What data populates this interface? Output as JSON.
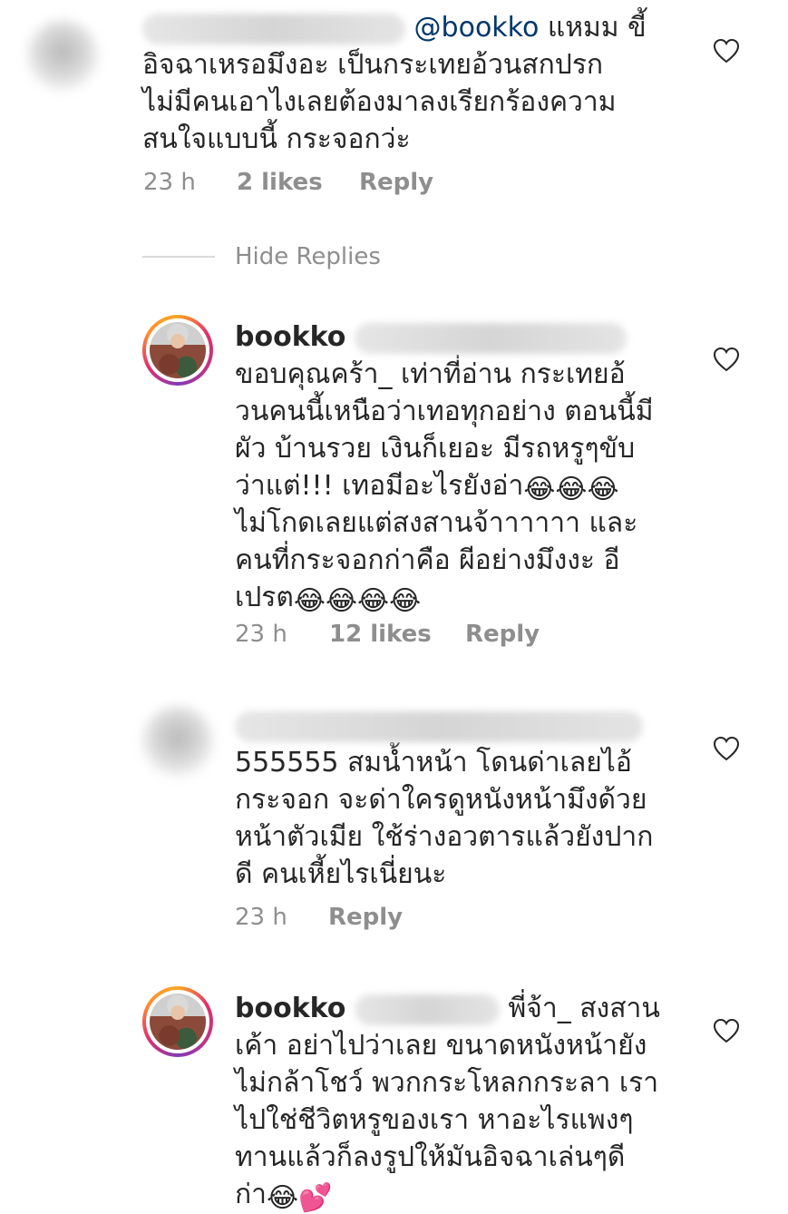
{
  "comments": [
    {
      "avatar": "blurred-avatar",
      "username": "",
      "mention": "@bookko",
      "lines": [
        "แหมม ขี้",
        "อิจฉาเหรอมึงอะ เป็นกระเทยอ้วนสกปรก",
        "ไม่มีคนเอาไงเลยต้องมาลงเรียกร้องความ",
        "สนใจแบบนี้ กระจอกว่ะ"
      ],
      "time": "23 h",
      "likes": "2 likes",
      "reply": "Reply"
    },
    {
      "avatar": "bookko-avatar",
      "username": "bookko",
      "lines": [
        "ขอบคุณคร้า_ เท่าที่อ่าน กระเทยอ้",
        "วนคนนี้เหนือว่าเทอทุกอย่าง ตอนนี้มี",
        "ผัว บ้านรวย เงินก็เยอะ มีรถหรูๆขับ",
        "ว่าแต่!!! เทอมีอะไรยังอ่า",
        "ไม่โกดเลยแต่สงสานจ้าาาาาา และ",
        "คนที่กระจอกก่าคือ ผีอย่างมึงงะ อี",
        "เปรต"
      ],
      "emoji_line4": "😂😂😂",
      "emoji_line7": "😂😂😂😂",
      "time": "23 h",
      "likes": "12 likes",
      "reply": "Reply"
    },
    {
      "avatar": "blurred-avatar",
      "username": "",
      "lines": [
        "555555 สมน้ำหน้า โดนด่าเลยไอ้",
        "กระจอก จะด่าใครดูหนังหน้ามึงด้วย",
        "หน้าตัวเมีย ใช้ร่างอวตารแล้วยังปาก",
        "ดี คนเหี้ยไรเนี่ยนะ"
      ],
      "time": "23 h",
      "reply": "Reply"
    },
    {
      "avatar": "bookko-avatar",
      "username": "bookko",
      "lines": [
        "พี่จ้า_ สงสาน",
        "เค้า อย่าไปว่าเลย ขนาดหนังหน้ายัง",
        "ไม่กล้าโชว์ พวกกระโหลกกระลา เรา",
        "ไปใช่ชีวิตหรูของเรา หาอะไรแพงๆ",
        "ทานแล้วก็ลงรูปให้มันอิจฉาเล่นๆดี",
        "ก่า"
      ],
      "emoji_last": "😂💕"
    }
  ],
  "hide_replies": "Hide Replies",
  "icons": {
    "like": "heart-outline-icon"
  },
  "colors": {
    "text": "#262626",
    "meta": "#8e8e8e",
    "mention": "#00376b",
    "divider": "#dbdbdb"
  }
}
